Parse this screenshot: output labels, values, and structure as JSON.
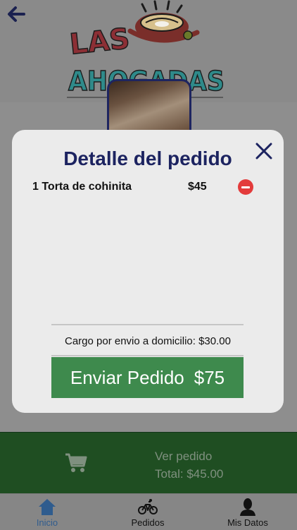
{
  "header": {
    "back_icon": "arrow-left-icon",
    "logo_text_line1": "LAS",
    "logo_text_line2": "AHOGADAS"
  },
  "modal": {
    "title": "Detalle del pedido",
    "close_icon": "close-icon",
    "items": [
      {
        "label": "1 Torta de cohinita",
        "price": "$45",
        "remove_icon": "remove-icon"
      }
    ],
    "shipping_label": "Cargo por envio a domicilio: $30.00",
    "send_button_label": "Enviar Pedido",
    "send_button_total": "$75"
  },
  "cart_bar": {
    "icon": "cart-icon",
    "line1": "Ver pedido",
    "line2": "Total: $45.00"
  },
  "tabs": [
    {
      "label": "Inicio",
      "icon": "home-icon",
      "active": true
    },
    {
      "label": "Pedidos",
      "icon": "bicycle-icon",
      "active": false
    },
    {
      "label": "Mis Datos",
      "icon": "user-icon",
      "active": false
    }
  ],
  "colors": {
    "title": "#1c2360",
    "send_button": "#3e8a4d",
    "remove": "#e33b3b",
    "cart_bar": "#1f4e22",
    "active_tab": "#2f5c8e"
  }
}
